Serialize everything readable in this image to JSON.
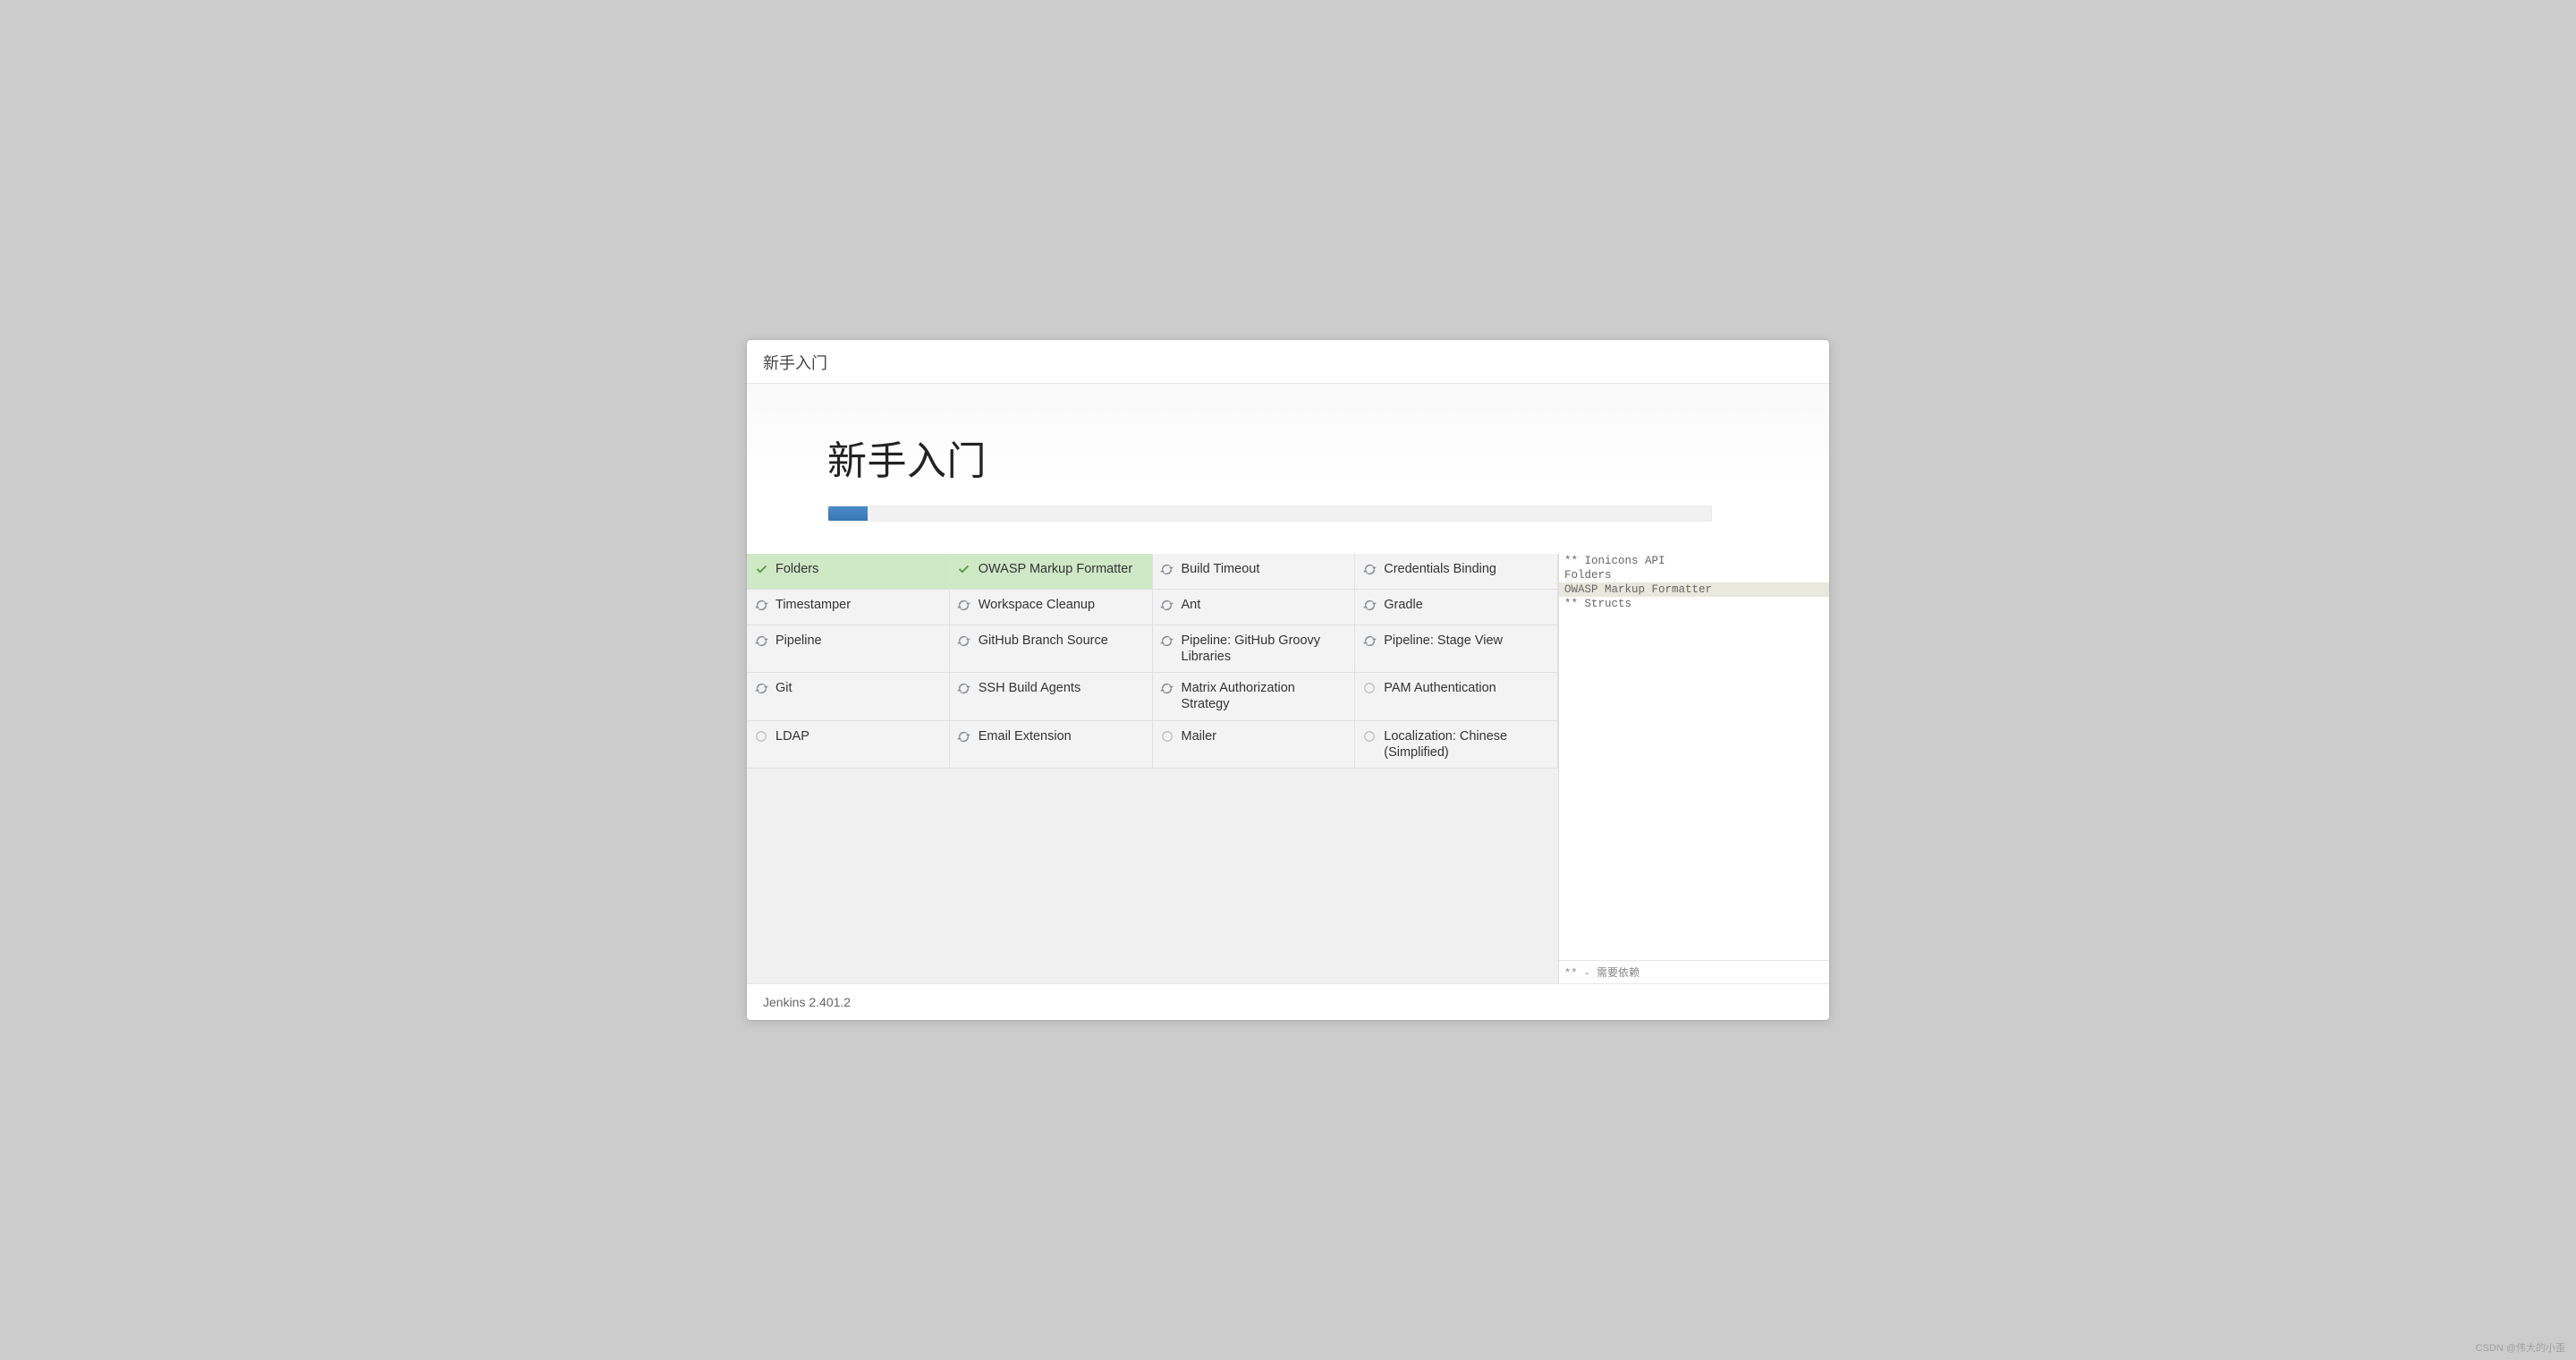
{
  "window_title": "新手入门",
  "hero": {
    "title": "新手入门",
    "progress_percent": 4.5
  },
  "plugins": [
    {
      "name": "Folders",
      "status": "success"
    },
    {
      "name": "OWASP Markup Formatter",
      "status": "success"
    },
    {
      "name": "Build Timeout",
      "status": "syncing"
    },
    {
      "name": "Credentials Binding",
      "status": "syncing"
    },
    {
      "name": "Timestamper",
      "status": "syncing"
    },
    {
      "name": "Workspace Cleanup",
      "status": "syncing"
    },
    {
      "name": "Ant",
      "status": "syncing"
    },
    {
      "name": "Gradle",
      "status": "syncing"
    },
    {
      "name": "Pipeline",
      "status": "syncing"
    },
    {
      "name": "GitHub Branch Source",
      "status": "syncing"
    },
    {
      "name": "Pipeline: GitHub Groovy Libraries",
      "status": "syncing"
    },
    {
      "name": "Pipeline: Stage View",
      "status": "syncing"
    },
    {
      "name": "Git",
      "status": "syncing"
    },
    {
      "name": "SSH Build Agents",
      "status": "syncing"
    },
    {
      "name": "Matrix Authorization Strategy",
      "status": "syncing"
    },
    {
      "name": "PAM Authentication",
      "status": "pending"
    },
    {
      "name": "LDAP",
      "status": "pending"
    },
    {
      "name": "Email Extension",
      "status": "syncing"
    },
    {
      "name": "Mailer",
      "status": "pending"
    },
    {
      "name": "Localization: Chinese (Simplified)",
      "status": "pending"
    }
  ],
  "log": {
    "lines": [
      {
        "text": "** Ionicons API",
        "highlight": false
      },
      {
        "text": "Folders",
        "highlight": false
      },
      {
        "text": "OWASP Markup Formatter",
        "highlight": true
      },
      {
        "text": "** Structs",
        "highlight": false
      }
    ],
    "footer": "** - 需要依赖"
  },
  "footer_text": "Jenkins 2.401.2",
  "watermark": "CSDN @伟大的小歪"
}
